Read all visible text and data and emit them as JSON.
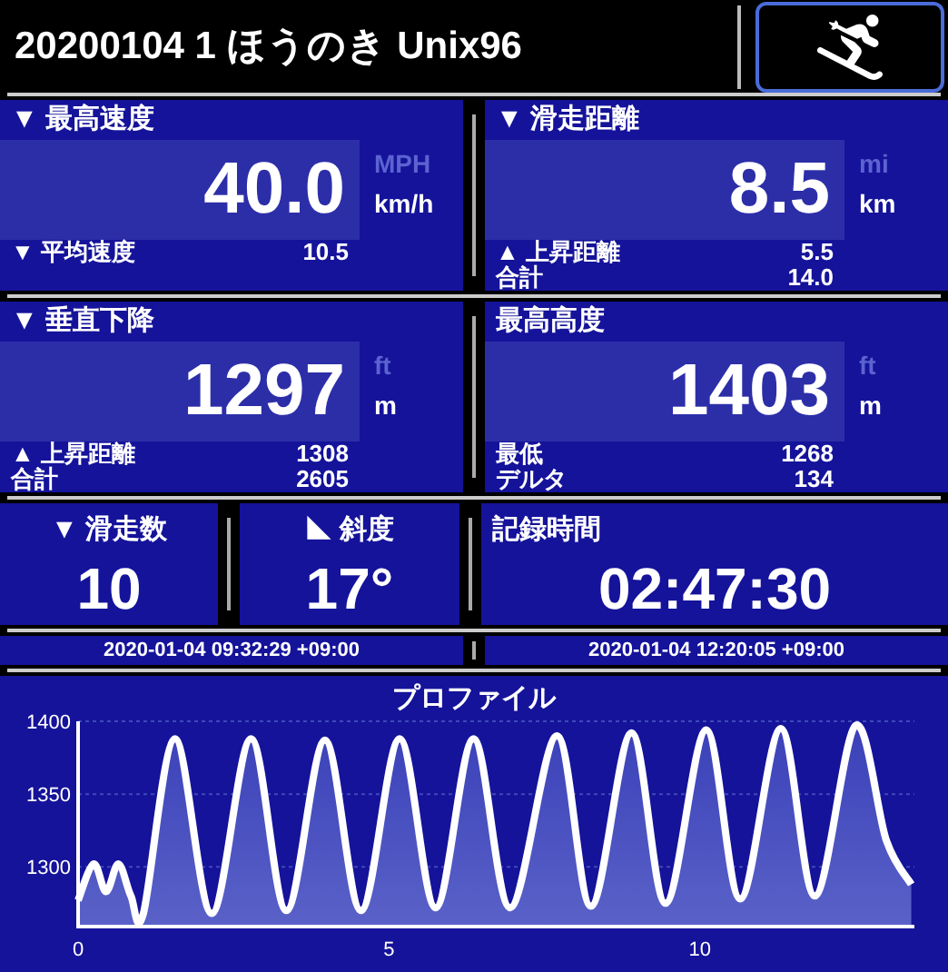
{
  "header": {
    "title": "20200104 1 ほうのき Unix96"
  },
  "panels": [
    {
      "label": "▼ 最高速度",
      "value": "40.0",
      "units": [
        {
          "label": "MPH",
          "selected": false
        },
        {
          "label": "km/h",
          "selected": true
        }
      ],
      "rows": [
        {
          "label": "▼ 平均速度",
          "value": "10.5"
        }
      ]
    },
    {
      "label": "▼ 滑走距離",
      "value": "8.5",
      "units": [
        {
          "label": "mi",
          "selected": false
        },
        {
          "label": "km",
          "selected": true
        }
      ],
      "rows": [
        {
          "label": "▲ 上昇距離",
          "value": "5.5"
        },
        {
          "label": "合計",
          "value": "14.0"
        }
      ]
    },
    {
      "label": "▼ 垂直下降",
      "value": "1297",
      "units": [
        {
          "label": "ft",
          "selected": false
        },
        {
          "label": "m",
          "selected": true
        }
      ],
      "rows": [
        {
          "label": "▲ 上昇距離",
          "value": "1308"
        },
        {
          "label": "合計",
          "value": "2605"
        }
      ]
    },
    {
      "label": "最高高度",
      "value": "1403",
      "units": [
        {
          "label": "ft",
          "selected": false
        },
        {
          "label": "m",
          "selected": true
        }
      ],
      "rows": [
        {
          "label": "最低",
          "value": "1268"
        },
        {
          "label": "デルタ",
          "value": "134"
        }
      ]
    }
  ],
  "stats": [
    {
      "label": "▼ 滑走数",
      "value": "10"
    },
    {
      "label": "◣ 斜度",
      "value": "17°"
    },
    {
      "label": "記録時間",
      "value": "02:47:30"
    }
  ],
  "times": [
    "2020-01-04 09:32:29 +09:00",
    "2020-01-04 12:20:05 +09:00"
  ],
  "profile": {
    "chart_data": {
      "type": "area",
      "title": "プロファイル",
      "x": [
        0,
        0.25,
        0.45,
        0.65,
        0.85,
        1.05,
        1.56,
        2.15,
        2.78,
        3.35,
        3.97,
        4.55,
        5.17,
        5.75,
        6.36,
        6.95,
        7.7,
        8.25,
        8.9,
        9.45,
        10.1,
        10.65,
        11.3,
        11.85,
        12.5,
        13.0,
        13.4
      ],
      "series": [
        {
          "color": "#ffffff",
          "values": [
            1277,
            1302,
            1283,
            1302,
            1280,
            1268,
            1388,
            1268,
            1388,
            1270,
            1387,
            1270,
            1388,
            1272,
            1388,
            1272,
            1390,
            1273,
            1392,
            1275,
            1394,
            1278,
            1395,
            1280,
            1397,
            1318,
            1288
          ]
        }
      ],
      "xlim": [
        0,
        13.45
      ],
      "ylim": [
        1259,
        1400
      ],
      "xticks": [
        0,
        5,
        10
      ],
      "yticks": [
        1300,
        1350,
        1400
      ]
    }
  }
}
